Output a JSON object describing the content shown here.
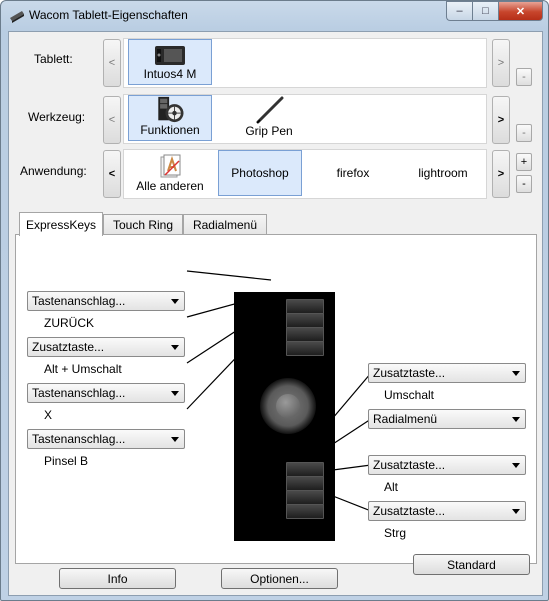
{
  "window": {
    "title": "Wacom Tablett-Eigenschaften",
    "min_glyph": "–",
    "max_glyph": "□",
    "close_glyph": "✕"
  },
  "rows": {
    "tablet": {
      "label": "Tablett:",
      "items": [
        {
          "label": "Intuos4 M",
          "icon": "tablet-icon",
          "selected": true
        }
      ],
      "prev": "<",
      "next": ">",
      "remove": "-"
    },
    "tool": {
      "label": "Werkzeug:",
      "items": [
        {
          "label": "Funktionen",
          "icon": "functions-icon",
          "selected": true
        },
        {
          "label": "Grip Pen",
          "icon": "pen-icon",
          "selected": false
        }
      ],
      "prev": "<",
      "next": ">",
      "remove": "-"
    },
    "app": {
      "label": "Anwendung:",
      "items": [
        {
          "label": "Alle anderen",
          "icon": "all-apps-icon",
          "selected": false
        },
        {
          "label": "Photoshop",
          "selected": true
        },
        {
          "label": "firefox",
          "selected": false
        },
        {
          "label": "lightroom",
          "selected": false
        }
      ],
      "prev": "<",
      "next": ">",
      "add": "+",
      "remove": "-"
    }
  },
  "tabs": [
    "ExpressKeys",
    "Touch Ring",
    "Radialmenü"
  ],
  "active_tab": "ExpressKeys",
  "left_keys": [
    {
      "dropdown": "Tastenanschlag...",
      "value": "ZURÜCK"
    },
    {
      "dropdown": "Zusatztaste...",
      "value": "Alt + Umschalt"
    },
    {
      "dropdown": "Tastenanschlag...",
      "value": "X"
    },
    {
      "dropdown": "Tastenanschlag...",
      "value": "Pinsel B"
    }
  ],
  "right_keys": [
    {
      "dropdown": "Zusatztaste...",
      "value": "Umschalt"
    },
    {
      "dropdown": "Radialmenü",
      "value": ""
    },
    {
      "dropdown": "Zusatztaste...",
      "value": "Alt"
    },
    {
      "dropdown": "Zusatztaste...",
      "value": "Strg"
    }
  ],
  "buttons": {
    "standard": "Standard",
    "info": "Info",
    "options": "Optionen..."
  },
  "colors": {
    "selection_bg": "#dbe9fb",
    "selection_border": "#7aa0d4",
    "close_button": "#c7452c"
  }
}
